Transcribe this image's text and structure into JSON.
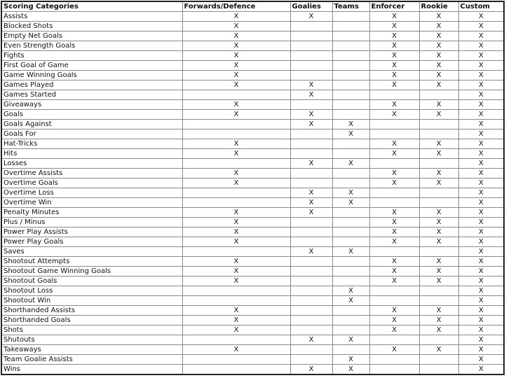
{
  "columns": [
    "Scoring Categories",
    "Forwards/Defence",
    "Goalies",
    "Teams",
    "Enforcer",
    "Rookie",
    "Custom"
  ],
  "mark_symbol": "X",
  "rows": [
    {
      "category": "Assists",
      "marks": [
        "X",
        "X",
        "",
        "X",
        "X",
        "X"
      ]
    },
    {
      "category": "Blocked Shots",
      "marks": [
        "X",
        "",
        "",
        "X",
        "X",
        "X"
      ]
    },
    {
      "category": "Empty Net Goals",
      "marks": [
        "X",
        "",
        "",
        "X",
        "X",
        "X"
      ]
    },
    {
      "category": "Even Strength Goals",
      "marks": [
        "X",
        "",
        "",
        "X",
        "X",
        "X"
      ]
    },
    {
      "category": "Fights",
      "marks": [
        "X",
        "",
        "",
        "X",
        "X",
        "X"
      ]
    },
    {
      "category": "First Goal of Game",
      "marks": [
        "X",
        "",
        "",
        "X",
        "X",
        "X"
      ]
    },
    {
      "category": "Game Winning Goals",
      "marks": [
        "X",
        "",
        "",
        "X",
        "X",
        "X"
      ]
    },
    {
      "category": "Games Played",
      "marks": [
        "X",
        "X",
        "",
        "X",
        "X",
        "X"
      ]
    },
    {
      "category": "Games Started",
      "marks": [
        "",
        "X",
        "",
        "",
        "",
        "X"
      ]
    },
    {
      "category": "Giveaways",
      "marks": [
        "X",
        "",
        "",
        "X",
        "X",
        "X"
      ]
    },
    {
      "category": "Goals",
      "marks": [
        "X",
        "X",
        "",
        "X",
        "X",
        "X"
      ]
    },
    {
      "category": "Goals Against",
      "marks": [
        "",
        "X",
        "X",
        "",
        "",
        "X"
      ]
    },
    {
      "category": "Goals For",
      "marks": [
        "",
        "",
        "X",
        "",
        "",
        "X"
      ]
    },
    {
      "category": "Hat-Tricks",
      "marks": [
        "X",
        "",
        "",
        "X",
        "X",
        "X"
      ]
    },
    {
      "category": "Hits",
      "marks": [
        "X",
        "",
        "",
        "X",
        "X",
        "X"
      ]
    },
    {
      "category": "Losses",
      "marks": [
        "",
        "X",
        "X",
        "",
        "",
        "X"
      ]
    },
    {
      "category": "Overtime Assists",
      "marks": [
        "X",
        "",
        "",
        "X",
        "X",
        "X"
      ]
    },
    {
      "category": "Overtime Goals",
      "marks": [
        "X",
        "",
        "",
        "X",
        "X",
        "X"
      ]
    },
    {
      "category": "Overtime Loss",
      "marks": [
        "",
        "X",
        "X",
        "",
        "",
        "X"
      ]
    },
    {
      "category": "Overtime Win",
      "marks": [
        "",
        "X",
        "X",
        "",
        "",
        "X"
      ]
    },
    {
      "category": "Penalty Minutes",
      "marks": [
        "X",
        "X",
        "",
        "X",
        "X",
        "X"
      ]
    },
    {
      "category": "Plus / Minus",
      "marks": [
        "X",
        "",
        "",
        "X",
        "X",
        "X"
      ]
    },
    {
      "category": "Power Play Assists",
      "marks": [
        "X",
        "",
        "",
        "X",
        "X",
        "X"
      ]
    },
    {
      "category": "Power Play Goals",
      "marks": [
        "X",
        "",
        "",
        "X",
        "X",
        "X"
      ]
    },
    {
      "category": "Saves",
      "marks": [
        "",
        "X",
        "X",
        "",
        "",
        "X"
      ]
    },
    {
      "category": "Shootout Attempts",
      "marks": [
        "X",
        "",
        "",
        "X",
        "X",
        "X"
      ]
    },
    {
      "category": "Shootout Game Winning Goals",
      "marks": [
        "X",
        "",
        "",
        "X",
        "X",
        "X"
      ]
    },
    {
      "category": "Shootout Goals",
      "marks": [
        "X",
        "",
        "",
        "X",
        "X",
        "X"
      ]
    },
    {
      "category": "Shootout Loss",
      "marks": [
        "",
        "",
        "X",
        "",
        "",
        "X"
      ]
    },
    {
      "category": "Shootout Win",
      "marks": [
        "",
        "",
        "X",
        "",
        "",
        "X"
      ]
    },
    {
      "category": "Shorthanded Assists",
      "marks": [
        "X",
        "",
        "",
        "X",
        "X",
        "X"
      ]
    },
    {
      "category": "Shorthanded Goals",
      "marks": [
        "X",
        "",
        "",
        "X",
        "X",
        "X"
      ]
    },
    {
      "category": "Shots",
      "marks": [
        "X",
        "",
        "",
        "X",
        "X",
        "X"
      ]
    },
    {
      "category": "Shutouts",
      "marks": [
        "",
        "X",
        "X",
        "",
        "",
        "X"
      ]
    },
    {
      "category": "Takeaways",
      "marks": [
        "X",
        "",
        "",
        "X",
        "X",
        "X"
      ]
    },
    {
      "category": "Team Goalie Assists",
      "marks": [
        "",
        "",
        "X",
        "",
        "",
        "X"
      ]
    },
    {
      "category": "Wins",
      "marks": [
        "",
        "X",
        "X",
        "",
        "",
        "X"
      ]
    }
  ]
}
